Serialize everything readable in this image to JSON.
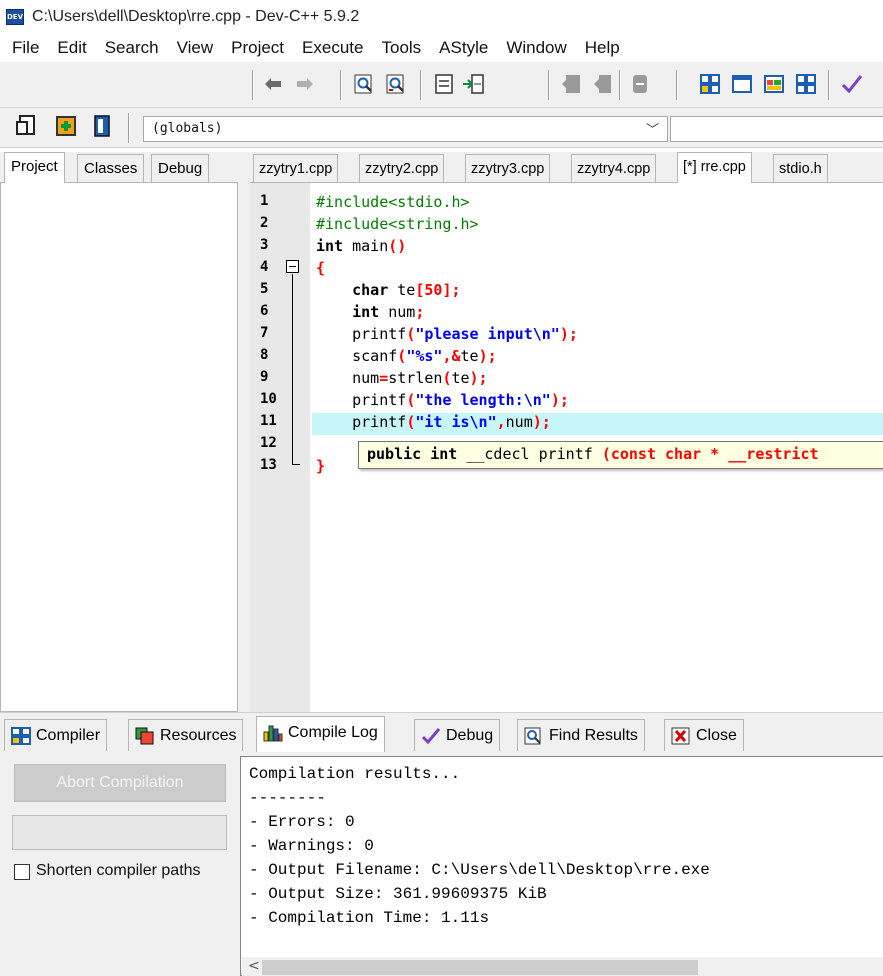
{
  "window": {
    "title": "C:\\Users\\dell\\Desktop\\rre.cpp - Dev-C++ 5.9.2",
    "logo_text": "DEV"
  },
  "menu": [
    "File",
    "Edit",
    "Search",
    "View",
    "Project",
    "Execute",
    "Tools",
    "AStyle",
    "Window",
    "Help"
  ],
  "toolbar2": {
    "globals_value": "(globals)",
    "dropdown_arrow": "﹀"
  },
  "left_tabs": [
    "Project",
    "Classes",
    "Debug"
  ],
  "editor_tabs": [
    "zzytry1.cpp",
    "zzytry2.cpp",
    "zzytry3.cpp",
    "zzytry4.cpp",
    "[*] rre.cpp",
    "stdio.h"
  ],
  "editor": {
    "line_numbers": [
      "1",
      "2",
      "3",
      "4",
      "5",
      "6",
      "7",
      "8",
      "9",
      "10",
      "11",
      "12",
      "13"
    ],
    "highlighted_line": "11",
    "code": {
      "l1": "#include<stdio.h>",
      "l2": "#include<string.h>",
      "l3_kw": "int",
      "l3_rest": " main",
      "l3_paren": "()",
      "l4": "{",
      "l5_kw": "char",
      "l5_id": " te",
      "l5_num": "50",
      "l6_kw": "int",
      "l6_id": " num",
      "l7_fn": "printf",
      "l7_str": "\"please input\\n\"",
      "l8_fn": "scanf",
      "l8_str": "\"%s\"",
      "l8_rest": "te",
      "l9_a": "num",
      "l9_b": "strlen",
      "l9_c": "te",
      "l10_fn": "printf",
      "l10_str": "\"the length:\\n\"",
      "l11_fn": "printf",
      "l11_str": "\"it is\\n\"",
      "l11_rest": "num",
      "l13": "}"
    },
    "tooltip": {
      "part1": "public int ",
      "part2": "__cdecl printf ",
      "part3": "(const char * __restrict"
    }
  },
  "bottom_tabs": [
    "Compiler",
    "Resources",
    "Compile Log",
    "Debug",
    "Find Results",
    "Close"
  ],
  "bottom": {
    "abort_button": "Abort Compilation",
    "shorten_label": "Shorten compiler paths",
    "scroll_left": "<",
    "log_lines": [
      "Compilation results...",
      "--------",
      "- Errors: 0",
      "- Warnings: 0",
      "- Output Filename: C:\\Users\\dell\\Desktop\\rre.exe",
      "- Output Size: 361.99609375 KiB",
      "- Compilation Time: 1.11s"
    ]
  }
}
